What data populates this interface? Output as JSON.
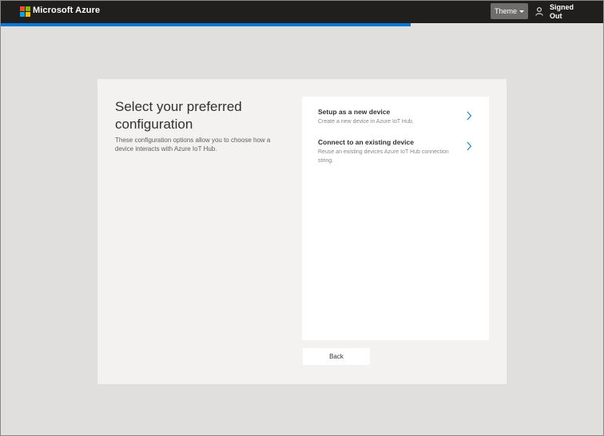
{
  "header": {
    "brand": "Microsoft Azure",
    "theme_label": "Theme",
    "user_status": "Signed Out",
    "logo_colors": [
      "#f25022",
      "#7fba00",
      "#00a4ef",
      "#ffb900"
    ]
  },
  "progress": {
    "fraction": 0.68,
    "color": "#0078d4"
  },
  "main": {
    "title": "Select your preferred configuration",
    "description": "These configuration options allow you to choose how a device interacts with Azure IoT Hub.",
    "options": [
      {
        "title": "Setup as a new device",
        "subtitle": "Create a new device in Azure IoT Hub."
      },
      {
        "title": "Connect to an existing device",
        "subtitle": "Reuse an existing devices Azure IoT Hub connection string."
      }
    ],
    "back_label": "Back"
  },
  "icons": {
    "user": "person-icon",
    "chevron": "chevron-right-icon"
  }
}
